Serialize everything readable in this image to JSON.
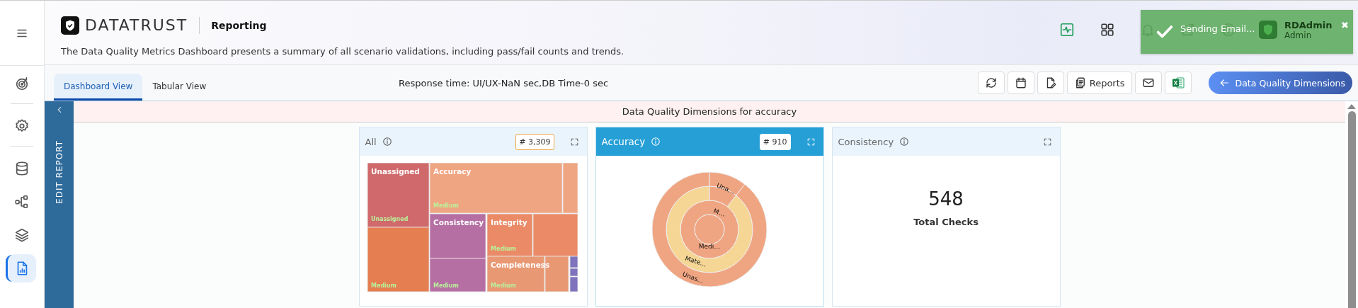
{
  "rail": {
    "items": [
      {
        "selected": false
      },
      {
        "selected": false
      },
      {
        "selected": false
      },
      {
        "selected": false
      },
      {
        "selected": false
      },
      {
        "selected": true
      }
    ]
  },
  "header": {
    "brand": "DATATRUST",
    "section": "Reporting",
    "description": "The Data Quality Metrics Dashboard presents a summary of all scenario validations, including pass/fail counts and trends.",
    "user_name": "RDAdmin",
    "user_role": "Admin"
  },
  "toast": {
    "message": "Sending Email...",
    "close": "✖"
  },
  "tabs": [
    {
      "label": "Dashboard View",
      "selected": true
    },
    {
      "label": "Tabular View",
      "selected": false
    }
  ],
  "response_time": "Response time: UI/UX-NaN sec,DB Time-0 sec",
  "reports_button": "Reports",
  "dimensions_button": "Data Quality Dimensions",
  "edit_report": "EDIT REPORT",
  "banner": "Data Quality Dimensions for accuracy",
  "cards": [
    {
      "title": "All",
      "selected": false,
      "count": "# 3,309",
      "kind": "treemap",
      "cells": [
        {
          "label": "Unassigned",
          "sublabel": "Unassigned",
          "color": "#d0696b"
        },
        {
          "sublabel": "Medium",
          "color": "#e57f52"
        },
        {
          "label": "Accuracy",
          "sublabel": "Medium",
          "color": "#f0a582"
        },
        {
          "color": "#f0a582"
        },
        {
          "label": "Consistency",
          "color": "#b56fa3"
        },
        {
          "sublabel": "Medium",
          "color": "#b56fa3"
        },
        {
          "label": "Integrity",
          "sublabel": "Medium",
          "color": "#eb8a67"
        },
        {
          "color": "#eb8a67"
        },
        {
          "label": "Completeness",
          "sublabel": "Medium",
          "color": "#e99874"
        },
        {
          "color": "#e99874"
        },
        {
          "color": "#7f73bd"
        },
        {
          "color": "#7f73bd"
        },
        {
          "color": "#7f73bd"
        }
      ]
    },
    {
      "title": "Accuracy",
      "selected": true,
      "count": "# 910",
      "kind": "sunburst",
      "segments": [
        {
          "color": "#f0a582"
        },
        {
          "label": "Medi…",
          "color": "#f0a582"
        },
        {
          "label": "Mate…",
          "color": "#f5d695"
        },
        {
          "label": "M…",
          "color": "#f0a582"
        },
        {
          "label": "Unas…",
          "color": "#f0a582"
        },
        {
          "label": "Una…",
          "color": "#f0a582"
        }
      ]
    },
    {
      "title": "Consistency",
      "selected": false,
      "kind": "total",
      "value": "548",
      "caption": "Total Checks"
    }
  ]
}
